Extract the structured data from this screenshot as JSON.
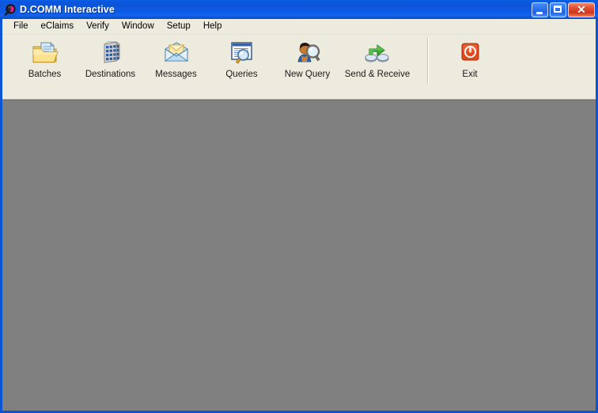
{
  "window": {
    "title": "D.COMM Interactive",
    "icon": "magnifier-app-icon",
    "frame_color": "#0a55d6",
    "titlebar_color": "#0f59e0",
    "client_color": "#808080",
    "chrome_color": "#edebde"
  },
  "window_controls": [
    {
      "name": "minimize",
      "label": "Minimize",
      "glyph": "_"
    },
    {
      "name": "maximize",
      "label": "Maximize",
      "glyph": "□"
    },
    {
      "name": "close",
      "label": "Close",
      "glyph": "✕",
      "color": "#d0351c"
    }
  ],
  "menu": {
    "items": [
      {
        "label": "File"
      },
      {
        "label": "eClaims"
      },
      {
        "label": "Verify"
      },
      {
        "label": "Window"
      },
      {
        "label": "Setup"
      },
      {
        "label": "Help"
      }
    ]
  },
  "toolbar": {
    "buttons": [
      {
        "label": "Batches",
        "icon": "folder-document-icon"
      },
      {
        "label": "Destinations",
        "icon": "building-icon"
      },
      {
        "label": "Messages",
        "icon": "open-envelope-icon"
      },
      {
        "label": "Queries",
        "icon": "document-magnifier-icon"
      },
      {
        "label": "New Query",
        "icon": "person-magnifier-icon"
      },
      {
        "label": "Send & Receive",
        "icon": "send-receive-arrow-icon"
      }
    ],
    "separator": true,
    "exit": {
      "label": "Exit",
      "icon": "power-exit-icon",
      "color": "#e04a20"
    }
  }
}
